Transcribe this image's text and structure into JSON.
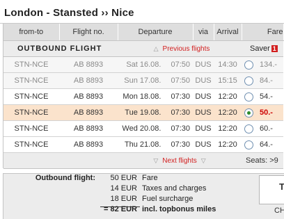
{
  "route": {
    "title": "London - Stansted ›› Nice"
  },
  "columns": {
    "from_to": "from-to",
    "flight_no": "Flight no.",
    "departure": "Departure",
    "via": "via",
    "arrival": "Arrival",
    "fare": "Fare"
  },
  "outbound": {
    "label": "OUTBOUND FLIGHT",
    "prev_link": "Previous flights",
    "next_link": "Next flights",
    "fare_class": "Saver",
    "fare_badge": "1",
    "seats_info": "Seats: >9"
  },
  "flights": [
    {
      "route": "STN-NCE",
      "flight": "AB 8893",
      "date": "Sat 16.08.",
      "dep": "07:50",
      "via": "DUS",
      "arr": "14:30",
      "price": "134.-",
      "selected": false
    },
    {
      "route": "STN-NCE",
      "flight": "AB 8893",
      "date": "Sun 17.08.",
      "dep": "07:50",
      "via": "DUS",
      "arr": "15:15",
      "price": "84.-",
      "selected": false
    },
    {
      "route": "STN-NCE",
      "flight": "AB 8893",
      "date": "Mon 18.08.",
      "dep": "07:30",
      "via": "DUS",
      "arr": "12:20",
      "price": "54.-",
      "selected": false
    },
    {
      "route": "STN-NCE",
      "flight": "AB 8893",
      "date": "Tue 19.08.",
      "dep": "07:30",
      "via": "DUS",
      "arr": "12:20",
      "price": "50.-",
      "selected": true
    },
    {
      "route": "STN-NCE",
      "flight": "AB 8893",
      "date": "Wed 20.08.",
      "dep": "07:30",
      "via": "DUS",
      "arr": "12:20",
      "price": "60.-",
      "selected": false
    },
    {
      "route": "STN-NCE",
      "flight": "AB 8893",
      "date": "Thu 21.08.",
      "dep": "07:30",
      "via": "DUS",
      "arr": "12:20",
      "price": "64.-",
      "selected": false
    }
  ],
  "summary": {
    "label": "Outbound flight:",
    "rows": [
      {
        "amount": "50 EUR",
        "desc": "Fare"
      },
      {
        "amount": "14 EUR",
        "desc": "Taxes and charges"
      },
      {
        "amount": "18 EUR",
        "desc": "Fuel surcharge"
      }
    ],
    "total_amount": "= 82 EUR",
    "total_desc": "incl. topbonus miles",
    "side_letter": "T",
    "side_text": "CH"
  },
  "colors": {
    "accent_red": "#d21e1e",
    "selected_row": "#fbe3cc",
    "header_grey": "#dedede"
  }
}
